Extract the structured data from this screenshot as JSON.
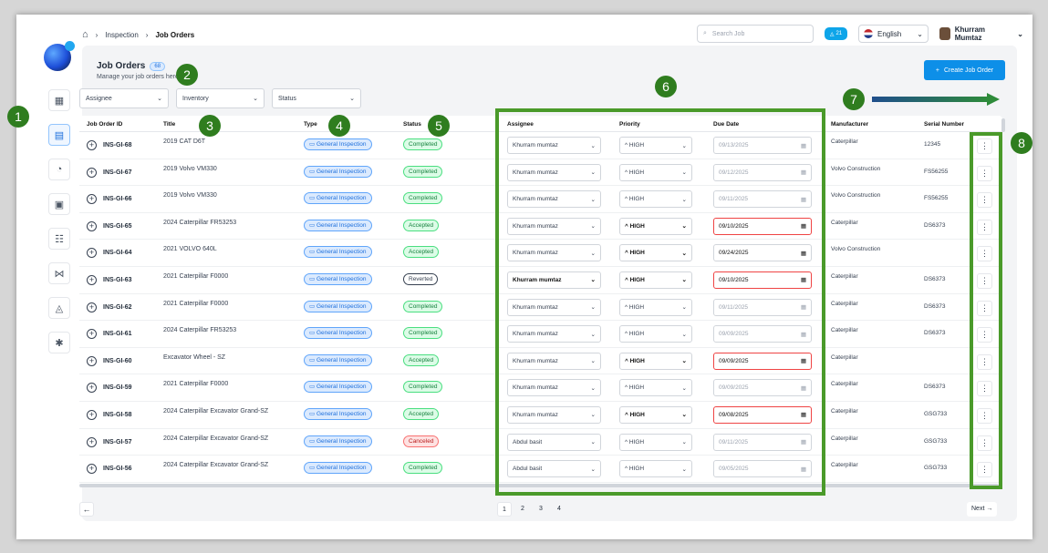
{
  "breadcrumb": {
    "section": "Inspection",
    "current": "Job Orders"
  },
  "search": {
    "placeholder": "Search Job"
  },
  "notifications": {
    "count": "21"
  },
  "language": {
    "selected": "English"
  },
  "user": {
    "name": "Khurram Mumtaz"
  },
  "page": {
    "title": "Job Orders",
    "count": "68",
    "subtitle": "Manage your job orders here",
    "create_label": "Create Job Order"
  },
  "filters": {
    "assignee": "Assignee",
    "inventory": "Inventory",
    "status": "Status"
  },
  "columns": {
    "id": "Job Order ID",
    "title": "Title",
    "type": "Type",
    "status": "Status",
    "assignee": "Assignee",
    "priority": "Priority",
    "due": "Due Date",
    "manufacturer": "Manufacturer",
    "serial": "Serial Number"
  },
  "rows": [
    {
      "id": "INS-GI-68",
      "title": "2019 CAT D6T",
      "type": "General Inspection",
      "status": "Completed",
      "assignee": "Khurram mumtaz",
      "priority": "HIGH",
      "due": "09/13/2025",
      "manufacturer": "Caterpillar",
      "serial": "12345",
      "overdue": false,
      "active": false
    },
    {
      "id": "INS-GI-67",
      "title": "2019 Volvo VM330",
      "type": "General Inspection",
      "status": "Completed",
      "assignee": "Khurram mumtaz",
      "priority": "HIGH",
      "due": "09/12/2025",
      "manufacturer": "Volvo Construction",
      "serial": "FS56255",
      "overdue": false,
      "active": false
    },
    {
      "id": "INS-GI-66",
      "title": "2019 Volvo VM330",
      "type": "General Inspection",
      "status": "Completed",
      "assignee": "Khurram mumtaz",
      "priority": "HIGH",
      "due": "09/11/2025",
      "manufacturer": "Volvo Construction",
      "serial": "FS56255",
      "overdue": false,
      "active": false
    },
    {
      "id": "INS-GI-65",
      "title": "2024 Caterpillar FR53253",
      "type": "General Inspection",
      "status": "Accepted",
      "assignee": "Khurram mumtaz",
      "priority": "HIGH",
      "due": "09/10/2025",
      "manufacturer": "Caterpillar",
      "serial": "DS6373",
      "overdue": true,
      "active": true
    },
    {
      "id": "INS-GI-64",
      "title": "2021 VOLVO 640L",
      "type": "General Inspection",
      "status": "Accepted",
      "assignee": "Khurram mumtaz",
      "priority": "HIGH",
      "due": "09/24/2025",
      "manufacturer": "Volvo Construction",
      "serial": "",
      "overdue": false,
      "active": true
    },
    {
      "id": "INS-GI-63",
      "title": "2021 Caterpillar F0000",
      "type": "General Inspection",
      "status": "Reverted",
      "assignee": "Khurram mumtaz",
      "priority": "HIGH",
      "due": "09/10/2025",
      "manufacturer": "Caterpillar",
      "serial": "DS6373",
      "overdue": true,
      "active": true,
      "bold_assignee": true
    },
    {
      "id": "INS-GI-62",
      "title": "2021 Caterpillar F0000",
      "type": "General Inspection",
      "status": "Completed",
      "assignee": "Khurram mumtaz",
      "priority": "HIGH",
      "due": "09/11/2025",
      "manufacturer": "Caterpillar",
      "serial": "DS6373",
      "overdue": false,
      "active": false
    },
    {
      "id": "INS-GI-61",
      "title": "2024 Caterpillar FR53253",
      "type": "General Inspection",
      "status": "Completed",
      "assignee": "Khurram mumtaz",
      "priority": "HIGH",
      "due": "09/09/2025",
      "manufacturer": "Caterpillar",
      "serial": "DS6373",
      "overdue": false,
      "active": false
    },
    {
      "id": "INS-GI-60",
      "title": "Excavator Wheel - SZ",
      "type": "General Inspection",
      "status": "Accepted",
      "assignee": "Khurram mumtaz",
      "priority": "HIGH",
      "due": "09/09/2025",
      "manufacturer": "Caterpillar",
      "serial": "",
      "overdue": true,
      "active": true
    },
    {
      "id": "INS-GI-59",
      "title": "2021 Caterpillar F0000",
      "type": "General Inspection",
      "status": "Completed",
      "assignee": "Khurram mumtaz",
      "priority": "HIGH",
      "due": "09/09/2025",
      "manufacturer": "Caterpillar",
      "serial": "DS6373",
      "overdue": false,
      "active": false
    },
    {
      "id": "INS-GI-58",
      "title": "2024 Caterpillar Excavator Grand-SZ",
      "type": "General Inspection",
      "status": "Accepted",
      "assignee": "Khurram mumtaz",
      "priority": "HIGH",
      "due": "09/08/2025",
      "manufacturer": "Caterpillar",
      "serial": "GSG733",
      "overdue": true,
      "active": true
    },
    {
      "id": "INS-GI-57",
      "title": "2024 Caterpillar Excavator Grand-SZ",
      "type": "General Inspection",
      "status": "Canceled",
      "assignee": "Abdul basit",
      "priority": "HIGH",
      "due": "09/11/2025",
      "manufacturer": "Caterpillar",
      "serial": "GSG733",
      "overdue": false,
      "active": false
    },
    {
      "id": "INS-GI-56",
      "title": "2024 Caterpillar Excavator Grand-SZ",
      "type": "General Inspection",
      "status": "Completed",
      "assignee": "Abdul basit",
      "priority": "HIGH",
      "due": "09/05/2025",
      "manufacturer": "Caterpillar",
      "serial": "GSG733",
      "overdue": false,
      "active": false
    }
  ],
  "pagination": {
    "pages": [
      "1",
      "2",
      "3",
      "4"
    ],
    "current": "1",
    "next_label": "Next"
  },
  "annotations": [
    "1",
    "2",
    "3",
    "4",
    "5",
    "6",
    "7",
    "8"
  ],
  "colors": {
    "accent": "#0d8fe8",
    "annotation": "#2f7d1f",
    "annotation_border": "#4a9a2a"
  }
}
